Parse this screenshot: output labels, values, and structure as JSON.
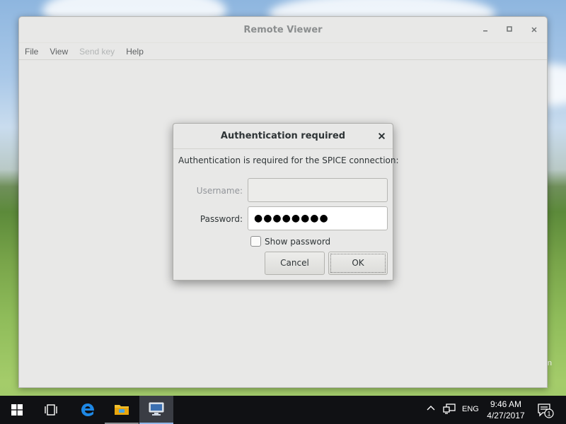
{
  "main_window": {
    "title": "Remote Viewer",
    "controls": {
      "minimize": "–",
      "maximize": "□",
      "close": "×"
    },
    "menu": [
      {
        "label": "File",
        "enabled": true
      },
      {
        "label": "View",
        "enabled": true
      },
      {
        "label": "Send key",
        "enabled": false
      },
      {
        "label": "Help",
        "enabled": true
      }
    ]
  },
  "dialog": {
    "title": "Authentication required",
    "close": "×",
    "message": "Authentication is required for the SPICE connection:",
    "username_label": "Username:",
    "username_value": "",
    "username_enabled": false,
    "password_label": "Password:",
    "password_value": "●●●●●●●●",
    "show_password_label": "Show password",
    "show_password_checked": false,
    "cancel_label": "Cancel",
    "ok_label": "OK"
  },
  "desktop": {
    "stray_text": "n"
  },
  "taskbar": {
    "icons": [
      "start-icon",
      "task-view-icon",
      "edge-icon",
      "file-explorer-icon",
      "remote-viewer-icon"
    ],
    "tray": {
      "chevron": "^",
      "language": "ENG",
      "time": "9:46 AM",
      "date": "4/27/2017",
      "notification_count": "1"
    }
  },
  "colors": {
    "window_bg": "#e8e8e7",
    "taskbar_bg": "#101114",
    "edge_blue": "#1e88e5",
    "folder_yellow": "#f2c12e"
  }
}
